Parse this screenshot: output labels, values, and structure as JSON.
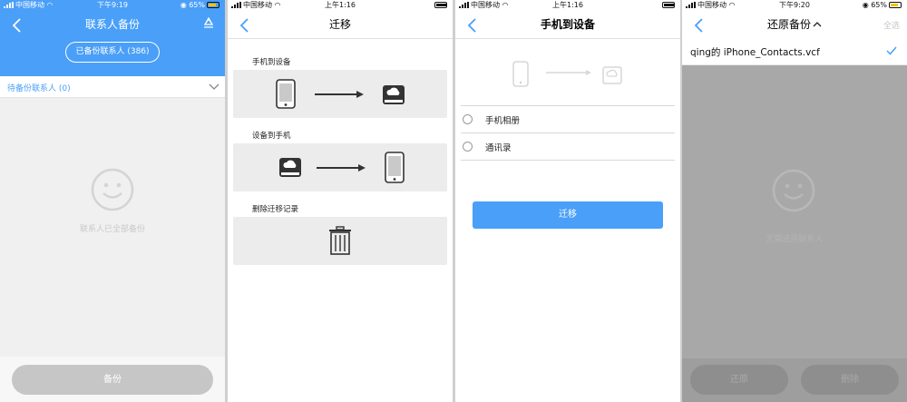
{
  "panels": [
    {
      "status": {
        "carrier": "中国移动",
        "time": "下午9:19",
        "battery": "65%"
      },
      "nav": {
        "title": "联系人备份"
      },
      "backed_up_pill": "已备份联系人 (386)",
      "pending_label": "待备份联系人 (0)",
      "empty_message": "联系人已全部备份",
      "backup_button": "备份",
      "colors": {
        "accent": "#4a9ff8"
      }
    },
    {
      "status": {
        "carrier": "中国移动",
        "time": "上午1:16"
      },
      "nav": {
        "title": "迁移"
      },
      "sections": [
        {
          "label": "手机到设备"
        },
        {
          "label": "设备到手机"
        },
        {
          "label": "删除迁移记录"
        }
      ]
    },
    {
      "status": {
        "carrier": "中国移动",
        "time": "上午1:16"
      },
      "nav": {
        "title": "手机到设备"
      },
      "options": [
        "手机相册",
        "通讯录"
      ],
      "migrate_button": "迁移"
    },
    {
      "status": {
        "carrier": "中国移动",
        "time": "下午9:20",
        "battery": "65%"
      },
      "nav": {
        "title": "还原备份",
        "select_all": "全选"
      },
      "file_name": "qing的 iPhone_Contacts.vcf",
      "empty_message": "无需还原联系人",
      "restore_button": "还原",
      "delete_button": "删除"
    }
  ]
}
